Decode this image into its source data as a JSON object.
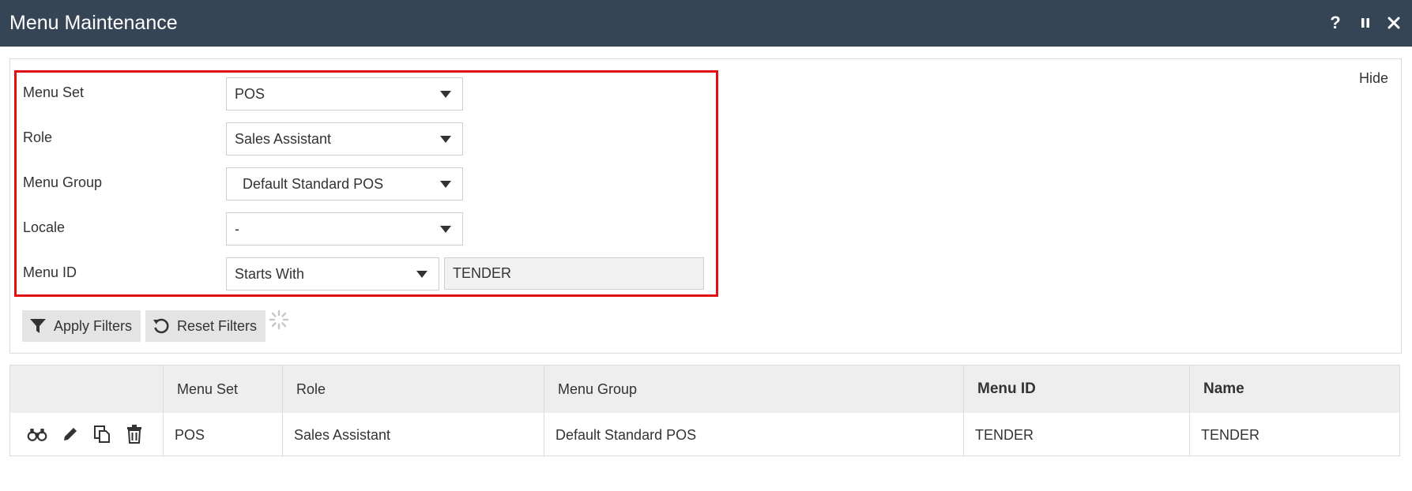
{
  "window": {
    "title": "Menu Maintenance",
    "help_label": "?",
    "icons": [
      "help-icon",
      "pause-icon",
      "close-icon"
    ]
  },
  "filters": {
    "hide_label": "Hide",
    "menu_set": {
      "label": "Menu Set",
      "value": "POS"
    },
    "role": {
      "label": "Role",
      "value": "Sales Assistant"
    },
    "menu_group": {
      "label": "Menu Group",
      "value": "Default Standard POS"
    },
    "locale": {
      "label": "Locale",
      "value": "-"
    },
    "menu_id": {
      "label": "Menu ID",
      "operator": "Starts With",
      "value": "TENDER"
    },
    "apply_label": "Apply Filters",
    "reset_label": "Reset Filters"
  },
  "table": {
    "columns": [
      "",
      "Menu Set",
      "Role",
      "Menu Group",
      "Menu ID",
      "Name"
    ],
    "rows": [
      {
        "menu_set": "POS",
        "role": "Sales Assistant",
        "menu_group": "Default Standard POS",
        "menu_id": "TENDER",
        "name": "TENDER",
        "actions": [
          "view-icon",
          "edit-icon",
          "copy-icon",
          "delete-icon"
        ]
      }
    ]
  },
  "colors": {
    "titlebar": "#364556",
    "highlight": "#e01010",
    "button_bg": "#e4e4e4",
    "header_bg": "#eeeeee"
  }
}
